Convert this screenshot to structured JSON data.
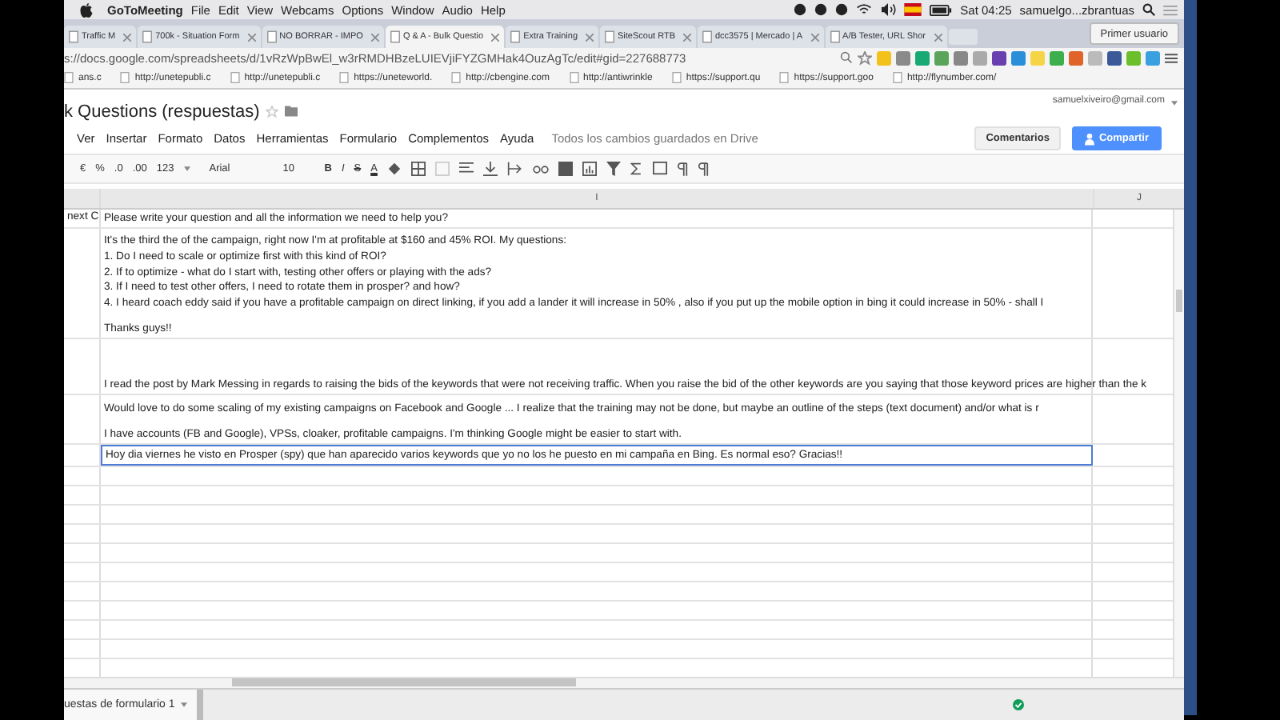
{
  "menubar": {
    "app": "GoToMeeting",
    "items": [
      "File",
      "Edit",
      "View",
      "Webcams",
      "Options",
      "Window",
      "Audio",
      "Help"
    ],
    "clock": "Sat 04:25",
    "user": "samuelgo...zbrantuas"
  },
  "tabs": [
    {
      "label": "Traffic M",
      "selected": false
    },
    {
      "label": "700k - Situation Form",
      "selected": false
    },
    {
      "label": "NO BORRAR - IMPO",
      "selected": false
    },
    {
      "label": "Q & A - Bulk Questio",
      "selected": true
    },
    {
      "label": "Extra Training",
      "selected": false
    },
    {
      "label": "SiteScout RTB",
      "selected": false
    },
    {
      "label": "dcc3575 | Mercado | A",
      "selected": false
    },
    {
      "label": "A/B Tester, URL Shor",
      "selected": false
    }
  ],
  "profile_button": "Primer usuario",
  "address": "s://docs.google.com/spreadsheets/d/1vRzWpBwEl_w3rRMDHBzeLUIEVjiFYZGMHak4OuzAgTc/edit#gid=227688773",
  "bookmarks": [
    "ans.c",
    "http://unetepubli.c",
    "http://unetepubli.c",
    "https://uneteworld.",
    "http://cbengine.com",
    "http://antiwrinkle",
    "https://support.qu",
    "https://support.goo",
    "http://flynumber.com/"
  ],
  "doc": {
    "title": "k Questions (respuestas)",
    "account": "samuelxiveiro@gmail.com",
    "menu": [
      "Ver",
      "Insertar",
      "Formato",
      "Datos",
      "Herramientas",
      "Formulario",
      "Complementos",
      "Ayuda"
    ],
    "save_status": "Todos los cambios guardados en Drive",
    "comments_button": "Comentarios",
    "share_button": "Compartir"
  },
  "toolbar": {
    "currency": "€",
    "percent": "%",
    "dec_less": ".0",
    "dec_more": ".00",
    "format": "123",
    "font": "Arial",
    "size": "10",
    "bold": "B",
    "italic": "I",
    "strike": "S",
    "text_color": "A"
  },
  "columns": [
    "I",
    "J"
  ],
  "header_row": {
    "left": "next C",
    "text": "Please write your question and all the information we need to help you?"
  },
  "rows": [
    {
      "selected": false,
      "paragraphs": [
        [
          "It's the third the of the campaign, right now I'm at profitable at $160 and 45% ROI. My questions:",
          "1. Do I need to scale or optimize first with this kind of ROI?",
          "2. If to optimize - what do I start with, testing other offers or playing with the ads?",
          "3. If I need to test other offers, I need to rotate them in prosper? and how?",
          "4. I heard coach eddy said if you have a profitable campaign on direct linking, if you add a lander it will increase in 50% , also if you put up the mobile option in bing it could increase in 50% - shall I"
        ],
        [
          "Thanks guys!!"
        ]
      ]
    },
    {
      "selected": false,
      "paragraphs": [
        [
          "I read the post by Mark Messing in regards to raising the bids of the keywords that were not receiving traffic. When you raise the bid of the other keywords are you saying that those keyword prices are higher than the k"
        ]
      ]
    },
    {
      "selected": false,
      "paragraphs": [
        [
          "Would love to do some scaling of my existing campaigns on Facebook and  Google ... I realize that the training may not be done, but maybe an outline of the steps (text document) and/or what is r"
        ],
        [
          "I have accounts (FB and Google), VPSs, cloaker, profitable campaigns.  I'm thinking Google might be easier to start with."
        ]
      ]
    },
    {
      "selected": true,
      "paragraphs": [
        [
          "Hoy dia viernes he visto en Prosper (spy)  que han aparecido varios keywords que yo no los he puesto en mi campaña en Bing. Es normal eso? Gracias!!"
        ]
      ]
    }
  ],
  "sheet_tab": "uestas de formulario 1"
}
